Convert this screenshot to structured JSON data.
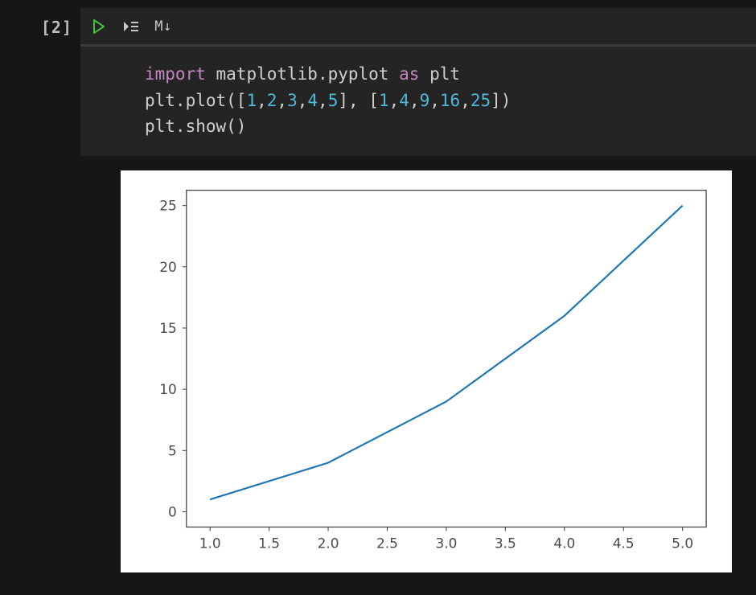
{
  "cell": {
    "execution_count": "[2]",
    "toolbar": {
      "run_tip": "Run",
      "run_all_tip": "Run by line",
      "markdown_label": "M↓"
    },
    "code": {
      "kw_import": "import",
      "mod_matplotlib": "matplotlib.pyplot",
      "kw_as": "as",
      "alias": "plt",
      "line2_a": "plt.plot(",
      "x_open": "[",
      "x0": "1",
      "x1": "2",
      "x2": "3",
      "x3": "4",
      "x4": "5",
      "x_close": "]",
      "comma_sep": ", ",
      "y_open": "[",
      "y0": "1",
      "y1": "4",
      "y2": "9",
      "y3": "16",
      "y4": "25",
      "y_close": "])",
      "line3": "plt.show()"
    }
  },
  "chart_data": {
    "type": "line",
    "x": [
      1,
      2,
      3,
      4,
      5
    ],
    "y": [
      1,
      4,
      9,
      16,
      25
    ],
    "x_ticks": [
      "1.0",
      "1.5",
      "2.0",
      "2.5",
      "3.0",
      "3.5",
      "4.0",
      "4.5",
      "5.0"
    ],
    "y_ticks": [
      "0",
      "5",
      "10",
      "15",
      "20",
      "25"
    ],
    "xlim": [
      1,
      5
    ],
    "ylim": [
      0,
      25
    ],
    "title": "",
    "xlabel": "",
    "ylabel": "",
    "line_color": "#1f77b4"
  }
}
